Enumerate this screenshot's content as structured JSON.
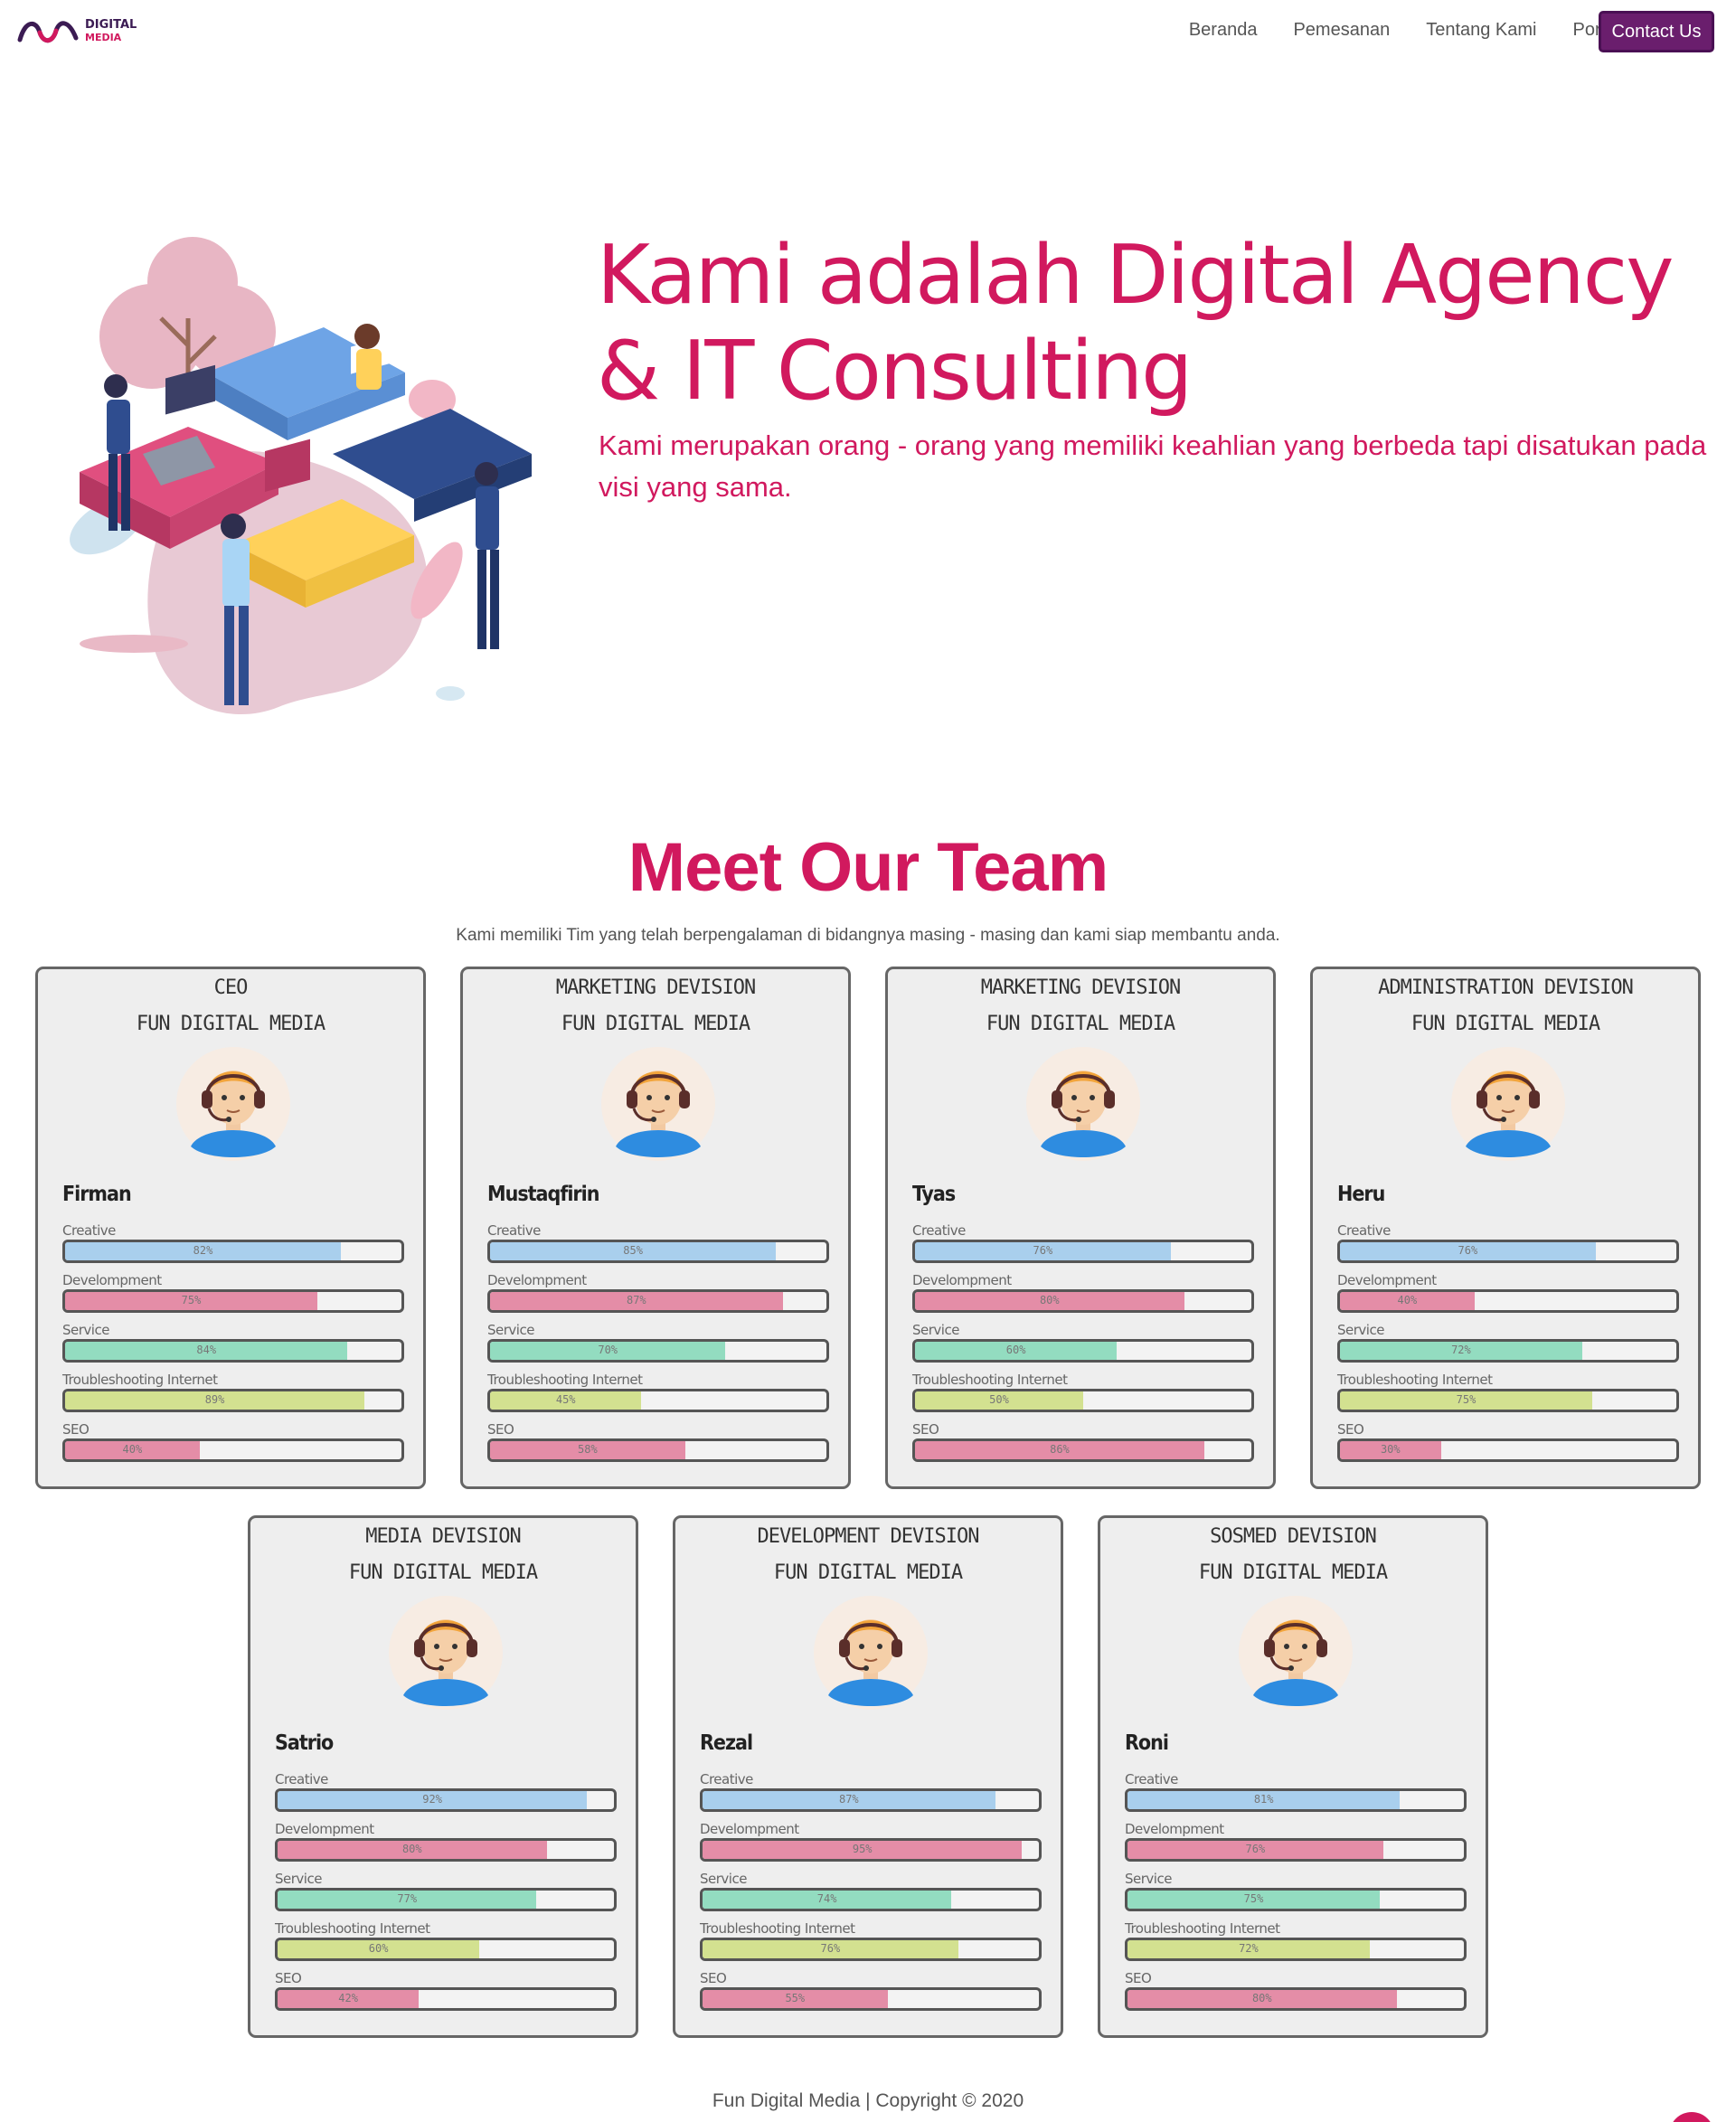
{
  "brand": {
    "line1": "DIGITAL",
    "line2": "MEDIA",
    "accent": "#d1195e",
    "dark": "#3b1b53"
  },
  "nav": {
    "items": [
      {
        "label": "Beranda"
      },
      {
        "label": "Pemesanan"
      },
      {
        "label": "Tentang Kami"
      },
      {
        "label": "Portofolio"
      }
    ],
    "contact_label": "Contact Us"
  },
  "hero": {
    "title": "Kami adalah Digital Agency & IT Consulting",
    "subtitle": "Kami merupakan orang - orang yang memiliki keahlian yang berbeda tapi disatukan pada visi yang sama.",
    "illustration_icon": "teamwork-puzzle-illustration"
  },
  "team": {
    "title": "Meet Our Team",
    "subtitle": "Kami memiliki Tim yang telah berpengalaman di bidangnya masing - masing dan kami siap membantu anda.",
    "skill_colors": [
      "#a9cfed",
      "#e48da7",
      "#93dcc0",
      "#d3e190",
      "#e48da7"
    ],
    "members": [
      {
        "role": "CEO",
        "company": "Fun Digital Media",
        "name": "Firman",
        "skills": [
          {
            "label": "Creative",
            "value": 82,
            "text": "82%"
          },
          {
            "label": "Develompment",
            "value": 75,
            "text": "75%"
          },
          {
            "label": "Service",
            "value": 84,
            "text": "84%"
          },
          {
            "label": "Troubleshooting Internet",
            "value": 89,
            "text": "89%"
          },
          {
            "label": "SEO",
            "value": 40,
            "text": "40%"
          }
        ]
      },
      {
        "role": "Marketing Devision",
        "company": "Fun Digital Media",
        "name": "Mustaqfirin",
        "skills": [
          {
            "label": "Creative",
            "value": 85,
            "text": "85%"
          },
          {
            "label": "Develompment",
            "value": 87,
            "text": "87%"
          },
          {
            "label": "Service",
            "value": 70,
            "text": "70%"
          },
          {
            "label": "Troubleshooting Internet",
            "value": 45,
            "text": "45%"
          },
          {
            "label": "SEO",
            "value": 58,
            "text": "58%"
          }
        ]
      },
      {
        "role": "Marketing Devision",
        "company": "Fun Digital Media",
        "name": "Tyas",
        "skills": [
          {
            "label": "Creative",
            "value": 76,
            "text": "76%"
          },
          {
            "label": "Develompment",
            "value": 80,
            "text": "80%"
          },
          {
            "label": "Service",
            "value": 60,
            "text": "60%"
          },
          {
            "label": "Troubleshooting Internet",
            "value": 50,
            "text": "50%"
          },
          {
            "label": "SEO",
            "value": 86,
            "text": "86%"
          }
        ]
      },
      {
        "role": "Administration Devision",
        "company": "Fun Digital Media",
        "name": "Heru",
        "skills": [
          {
            "label": "Creative",
            "value": 76,
            "text": "76%"
          },
          {
            "label": "Develompment",
            "value": 40,
            "text": "40%"
          },
          {
            "label": "Service",
            "value": 72,
            "text": "72%"
          },
          {
            "label": "Troubleshooting Internet",
            "value": 75,
            "text": "75%"
          },
          {
            "label": "SEO",
            "value": 30,
            "text": "30%"
          }
        ]
      },
      {
        "role": "Media Devision",
        "company": "Fun Digital Media",
        "name": "Satrio",
        "skills": [
          {
            "label": "Creative",
            "value": 92,
            "text": "92%"
          },
          {
            "label": "Develompment",
            "value": 80,
            "text": "80%"
          },
          {
            "label": "Service",
            "value": 77,
            "text": "77%"
          },
          {
            "label": "Troubleshooting Internet",
            "value": 60,
            "text": "60%"
          },
          {
            "label": "SEO",
            "value": 42,
            "text": "42%"
          }
        ]
      },
      {
        "role": "Development Devision",
        "company": "Fun Digital Media",
        "name": "Rezal",
        "skills": [
          {
            "label": "Creative",
            "value": 87,
            "text": "87%"
          },
          {
            "label": "Develompment",
            "value": 95,
            "text": "95%"
          },
          {
            "label": "Service",
            "value": 74,
            "text": "74%"
          },
          {
            "label": "Troubleshooting Internet",
            "value": 76,
            "text": "76%"
          },
          {
            "label": "SEO",
            "value": 55,
            "text": "55%"
          }
        ]
      },
      {
        "role": "Sosmed Devision",
        "company": "Fun Digital Media",
        "name": "Roni",
        "skills": [
          {
            "label": "Creative",
            "value": 81,
            "text": "81%"
          },
          {
            "label": "Develompment",
            "value": 76,
            "text": "76%"
          },
          {
            "label": "Service",
            "value": 75,
            "text": "75%"
          },
          {
            "label": "Troubleshooting Internet",
            "value": 72,
            "text": "72%"
          },
          {
            "label": "SEO",
            "value": 80,
            "text": "80%"
          }
        ]
      }
    ]
  },
  "footer": {
    "text": "Fun Digital Media | Copyright © 2020"
  }
}
